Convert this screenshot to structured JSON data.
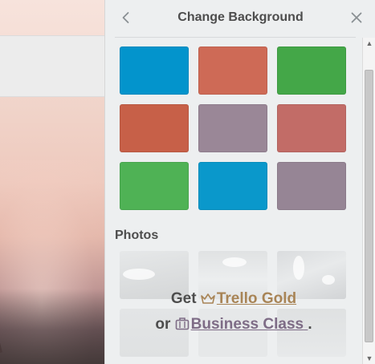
{
  "panel": {
    "title": "Change Background",
    "back_icon": "chevron-left-icon",
    "close_icon": "close-icon"
  },
  "colors": [
    {
      "name": "blue",
      "hex": "#0394cc"
    },
    {
      "name": "orange",
      "hex": "#ce6a56"
    },
    {
      "name": "green",
      "hex": "#44a748"
    },
    {
      "name": "red",
      "hex": "#c76048"
    },
    {
      "name": "purple",
      "hex": "#9a8797"
    },
    {
      "name": "pink",
      "hex": "#c26c67"
    },
    {
      "name": "lime",
      "hex": "#4fb255"
    },
    {
      "name": "sky",
      "hex": "#0a98cb"
    },
    {
      "name": "grey",
      "hex": "#968595"
    }
  ],
  "photos_section": {
    "title": "Photos"
  },
  "upsell": {
    "prefix": "Get",
    "gold_link": "Trello Gold",
    "connector": "or",
    "business_link": "Business Class",
    "suffix": ".",
    "gold_icon": "crown-icon",
    "business_icon": "briefcase-icon",
    "gold_color": "#a88456",
    "business_color": "#7e6c86"
  }
}
